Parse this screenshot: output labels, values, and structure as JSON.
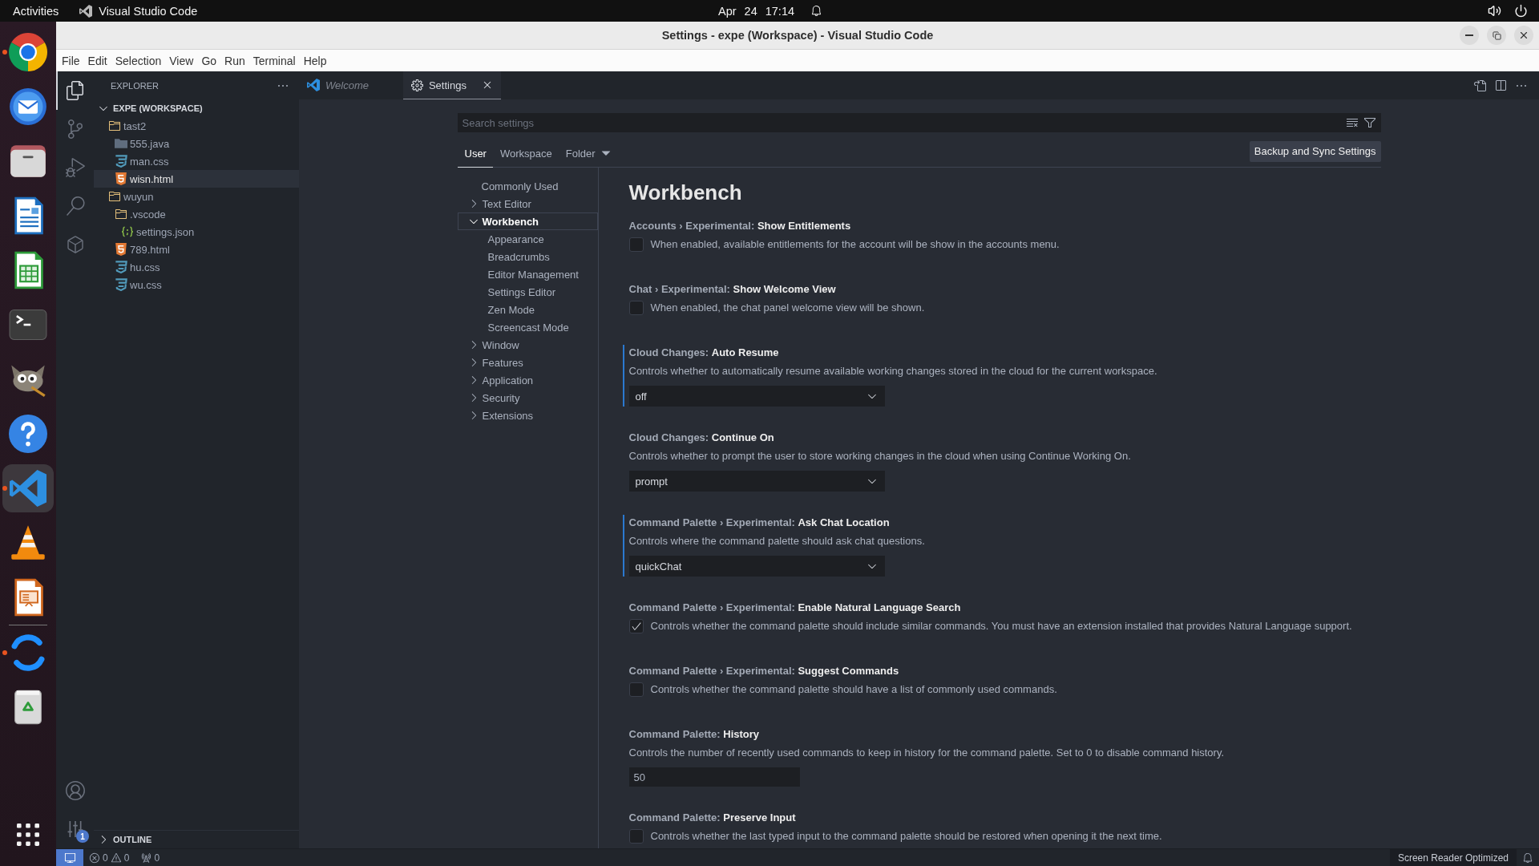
{
  "top_bar": {
    "activities": "Activities",
    "app_name": "Visual Studio Code",
    "date": "Apr 24",
    "time": "17:14"
  },
  "dock": {
    "apps": [
      {
        "kind": "browser",
        "running": true,
        "active": false
      },
      {
        "kind": "mail",
        "running": false,
        "active": false
      },
      {
        "kind": "files",
        "running": false,
        "active": false
      },
      {
        "kind": "writer",
        "running": false,
        "active": false
      },
      {
        "kind": "calc",
        "running": false,
        "active": false
      },
      {
        "kind": "terminal",
        "running": false,
        "active": false
      },
      {
        "kind": "paint",
        "running": false,
        "active": false
      },
      {
        "kind": "help",
        "running": false,
        "active": false
      },
      {
        "kind": "editor",
        "running": true,
        "active": true
      },
      {
        "kind": "player",
        "running": false,
        "active": false
      },
      {
        "kind": "impress",
        "running": false,
        "active": false
      }
    ],
    "extra_apps": [
      {
        "kind": "ring",
        "running": true,
        "active": false
      },
      {
        "kind": "trash",
        "running": false,
        "active": false
      }
    ]
  },
  "window": {
    "title": "Settings - expe (Workspace) - Visual Studio Code"
  },
  "menu": [
    "File",
    "Edit",
    "Selection",
    "View",
    "Go",
    "Run",
    "Terminal",
    "Help"
  ],
  "activity_bar": {
    "items": [
      {
        "kind": "explorer",
        "selected": true
      },
      {
        "kind": "source-control",
        "selected": false
      },
      {
        "kind": "run-debug",
        "selected": false
      },
      {
        "kind": "search",
        "selected": false
      },
      {
        "kind": "extensions",
        "selected": false
      }
    ],
    "bottom_items": [
      {
        "kind": "account"
      },
      {
        "kind": "manage",
        "badge": "1"
      }
    ]
  },
  "explorer": {
    "title": "EXPLORER",
    "workspace": "EXPE (WORKSPACE)",
    "expanded": true,
    "tree": [
      {
        "label": "tast2",
        "kind": "folder",
        "selected": false,
        "children": [
          {
            "label": "555.java",
            "kind": "filled-folder",
            "selected": false
          },
          {
            "label": "man.css",
            "kind": "css",
            "selected": false
          },
          {
            "label": "wisn.html",
            "kind": "html",
            "selected": true
          }
        ]
      },
      {
        "label": "wuyun",
        "kind": "folder",
        "selected": false,
        "children": [
          {
            "label": ".vscode",
            "kind": "folder",
            "selected": false,
            "children": [
              {
                "label": "settings.json",
                "kind": "json",
                "selected": false
              }
            ]
          },
          {
            "label": "789.html",
            "kind": "html",
            "selected": false
          },
          {
            "label": "hu.css",
            "kind": "css",
            "selected": false
          },
          {
            "label": "wu.css",
            "kind": "css",
            "selected": false
          }
        ]
      }
    ],
    "outline": {
      "label": "OUTLINE",
      "expanded": false
    }
  },
  "editor_tabs": [
    {
      "kind": "preview",
      "label": "Welcome",
      "selected": false
    },
    {
      "kind": "settings",
      "label": "Settings",
      "selected": true
    }
  ],
  "settings": {
    "search": {
      "placeholder": "Search settings"
    },
    "scopes": [
      {
        "kind": "tab",
        "label": "User",
        "selected": true
      },
      {
        "kind": "tab",
        "label": "Workspace",
        "selected": false
      },
      {
        "kind": "dropdown",
        "label": "Folder",
        "selected": false
      }
    ],
    "sync_button": "Backup and Sync Settings",
    "toc": [
      {
        "kind": "leaf",
        "label": "Commonly Used",
        "selected": false
      },
      {
        "kind": "group",
        "label": "Text Editor",
        "expanded": false,
        "selected": false
      },
      {
        "kind": "group",
        "label": "Workbench",
        "expanded": true,
        "selected": true,
        "children": [
          {
            "label": "Appearance",
            "selected": false
          },
          {
            "label": "Breadcrumbs",
            "selected": false
          },
          {
            "label": "Editor Management",
            "selected": false
          },
          {
            "label": "Settings Editor",
            "selected": false
          },
          {
            "label": "Zen Mode",
            "selected": false
          },
          {
            "label": "Screencast Mode",
            "selected": false
          }
        ]
      },
      {
        "kind": "group",
        "label": "Window",
        "expanded": false,
        "selected": false
      },
      {
        "kind": "group",
        "label": "Features",
        "expanded": false,
        "selected": false
      },
      {
        "kind": "group",
        "label": "Application",
        "expanded": false,
        "selected": false
      },
      {
        "kind": "group",
        "label": "Security",
        "expanded": false,
        "selected": false
      },
      {
        "kind": "group",
        "label": "Extensions",
        "expanded": false,
        "selected": false
      }
    ],
    "section_title": "Workbench",
    "items": [
      {
        "kind": "checkbox",
        "title": "Accounts › Experimental: **Show Entitlements**",
        "description": "When enabled, available entitlements for the account will be show in the accounts menu.",
        "checked": false,
        "modified": false
      },
      {
        "kind": "checkbox",
        "title": "Chat › Experimental: **Show Welcome View**",
        "description": "When enabled, the chat panel welcome view will be shown.",
        "checked": false,
        "modified": false
      },
      {
        "kind": "dropdown",
        "title": "Cloud Changes: **Auto Resume**",
        "description": "Controls whether to automatically resume available working changes stored in the cloud for the current workspace.",
        "value": "off",
        "modified": true
      },
      {
        "kind": "dropdown",
        "title": "Cloud Changes: **Continue On**",
        "description": "Controls whether to prompt the user to store working changes in the cloud when using Continue Working On.",
        "value": "prompt",
        "modified": false
      },
      {
        "kind": "dropdown",
        "title": "Command Palette › Experimental: **Ask Chat Location**",
        "description": "Controls where the command palette should ask chat questions.",
        "value": "quickChat",
        "modified": true
      },
      {
        "kind": "checkbox",
        "title": "Command Palette › Experimental: **Enable Natural Language Search**",
        "description": "Controls whether the command palette should include similar commands. You must have an extension installed that provides Natural Language support.",
        "checked": true,
        "modified": false
      },
      {
        "kind": "checkbox",
        "title": "Command Palette › Experimental: **Suggest Commands**",
        "description": "Controls whether the command palette should have a list of commonly used commands.",
        "checked": false,
        "modified": false
      },
      {
        "kind": "number",
        "title": "Command Palette: **History**",
        "description": "Controls the number of recently used commands to keep in history for the command palette. Set to 0 to disable command history.",
        "value": "50",
        "modified": false
      },
      {
        "kind": "checkbox",
        "title": "Command Palette: **Preserve Input**",
        "description": "Controls whether the last typed input to the command palette should be restored when opening it the next time.",
        "checked": false,
        "modified": false
      }
    ]
  },
  "status_bar": {
    "errors": "0",
    "warnings": "0",
    "ports": "0",
    "screen_reader": "Screen Reader Optimized"
  }
}
